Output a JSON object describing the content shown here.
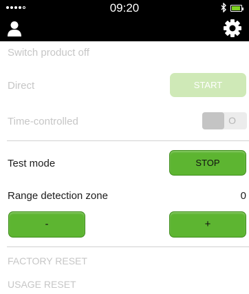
{
  "status_bar": {
    "time": "09:20",
    "bluetooth_icon": "bluetooth-icon",
    "battery_icon": "battery-icon"
  },
  "nav": {
    "user_icon": "user-icon",
    "settings_icon": "gear-icon"
  },
  "switch_off": {
    "heading": "Switch product off"
  },
  "direct": {
    "label": "Direct",
    "button": "START"
  },
  "time_controlled": {
    "label": "Time-controlled",
    "toggle_label": "O"
  },
  "test_mode": {
    "label": "Test mode",
    "button": "STOP"
  },
  "range": {
    "label": "Range detection zone",
    "value": "0",
    "minus": "-",
    "plus": "+"
  },
  "factory_reset": {
    "label": "FACTORY RESET"
  },
  "usage_reset": {
    "label": "USAGE RESET"
  },
  "colors": {
    "accent_green": "#5db531",
    "disabled_green": "#cfe9b7",
    "header_bg": "#000000"
  }
}
